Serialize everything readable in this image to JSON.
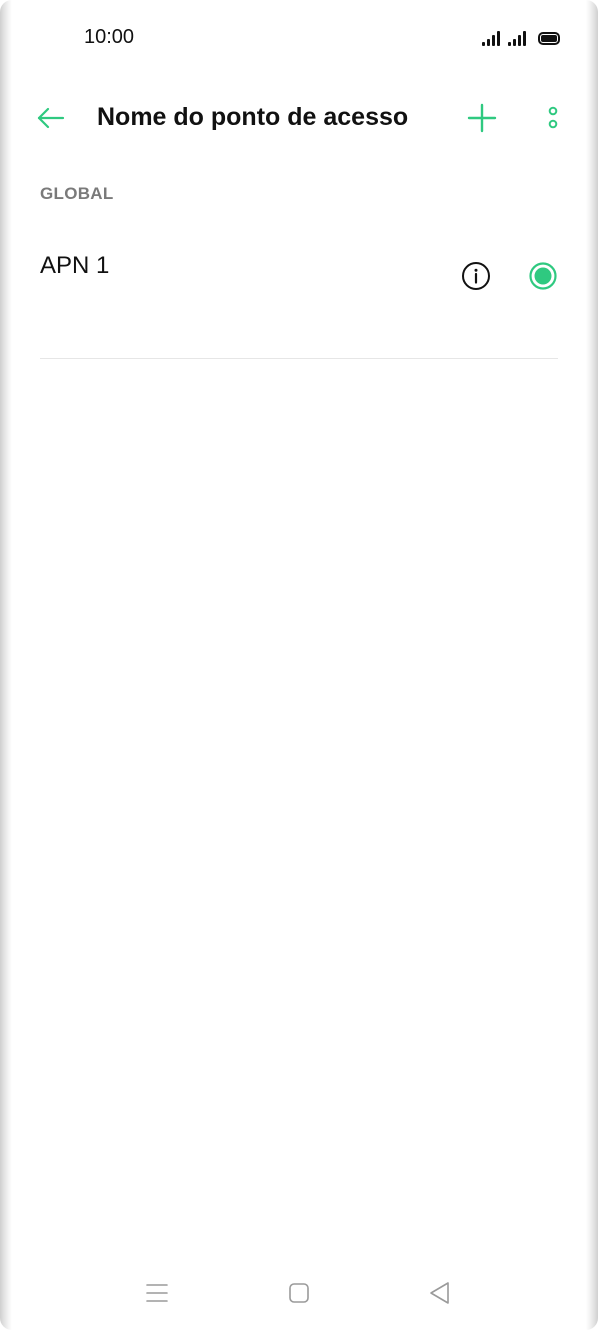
{
  "status_bar": {
    "time": "10:00",
    "icons": [
      "signal-icon",
      "signal-icon",
      "battery-icon"
    ]
  },
  "toolbar": {
    "title": "Nome do ponto de acesso",
    "back_icon": "arrow-left-icon",
    "add_icon": "plus-icon",
    "more_icon": "more-vertical-icon"
  },
  "section": {
    "header": "GLOBAL"
  },
  "apn_list": {
    "items": [
      {
        "name": "APN 1",
        "selected": true,
        "info_icon": "info-icon",
        "radio_icon": "radio-selected-icon"
      }
    ]
  },
  "nav_bar": {
    "icons": [
      "menu-icon",
      "home-icon",
      "back-triangle-icon"
    ]
  },
  "colors": {
    "accent": "#2fc980",
    "text": "#111111",
    "secondary_text": "#7a7a7a",
    "divider": "#e6e6e6",
    "nav_icon": "#9a9a9a"
  }
}
